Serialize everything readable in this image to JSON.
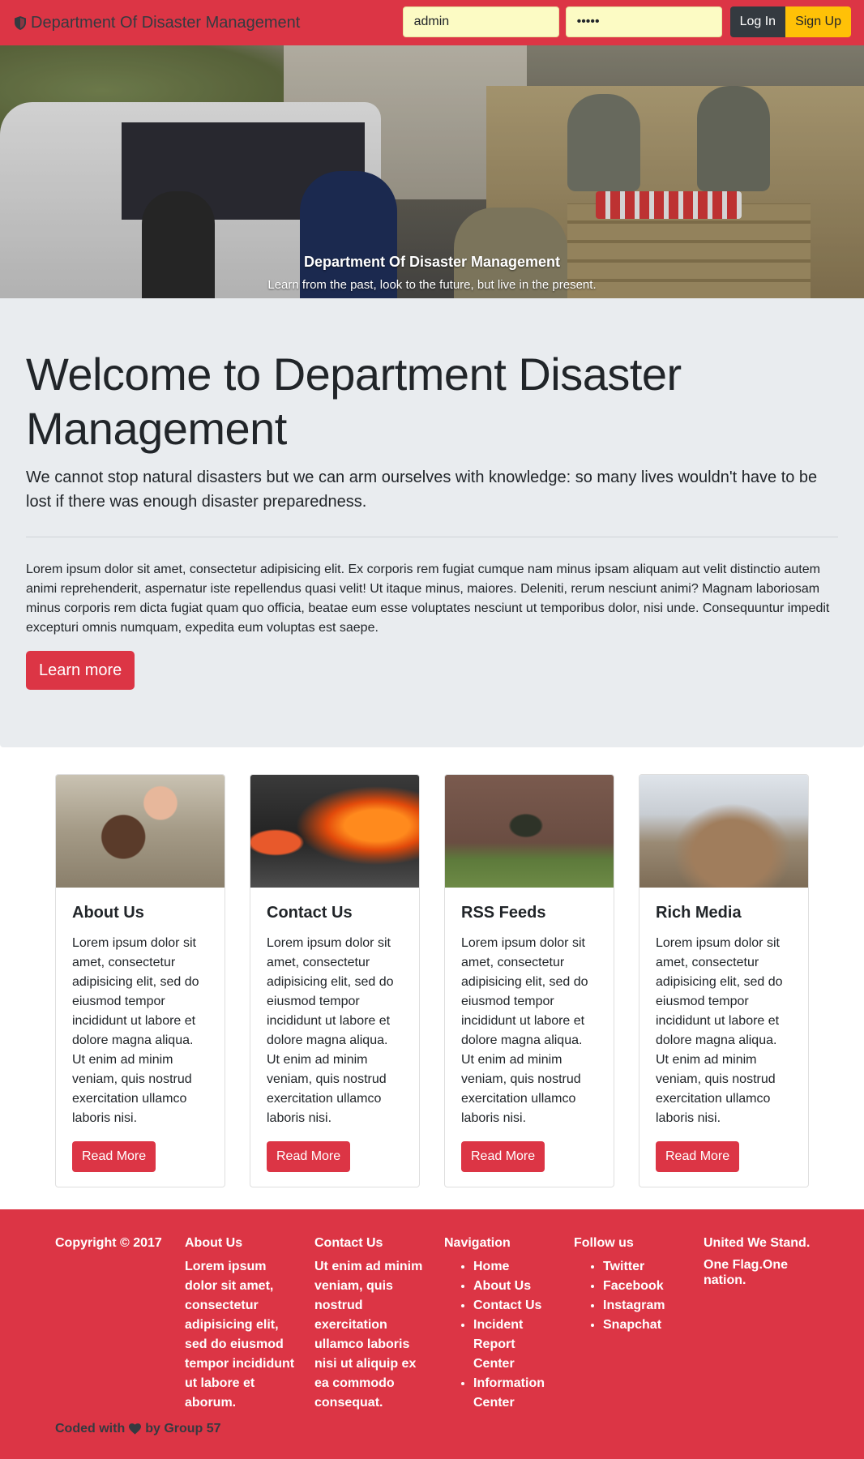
{
  "navbar": {
    "brand": "Department Of Disaster Management",
    "username_value": "admin",
    "password_value": "•••••",
    "login_label": "Log In",
    "signup_label": "Sign Up"
  },
  "hero": {
    "caption_title": "Department Of Disaster Management",
    "caption_text": "Learn from the past, look to the future, but live in the present."
  },
  "jumbotron": {
    "heading": "Welcome to Department Disaster Management",
    "lead": "We cannot stop natural disasters but we can arm ourselves with knowledge: so many lives wouldn't have to be lost if there was enough disaster preparedness.",
    "body": "Lorem ipsum dolor sit amet, consectetur adipisicing elit. Ex corporis rem fugiat cumque nam minus ipsam aliquam aut velit distinctio autem animi reprehenderit, aspernatur iste repellendus quasi velit! Ut itaque minus, maiores. Deleniti, rerum nesciunt animi? Magnam laboriosam minus corporis rem dicta fugiat quam quo officia, beatae eum esse voluptates nesciunt ut temporibus dolor, nisi unde. Consequuntur impedit excepturi omnis numquam, expedita eum voluptas est saepe.",
    "button_label": "Learn more"
  },
  "cards": [
    {
      "title": "About Us",
      "text": "Lorem ipsum dolor sit amet, consectetur adipisicing elit, sed do eiusmod tempor incididunt ut labore et dolore magna aliqua. Ut enim ad minim veniam, quis nostrud exercitation ullamco laboris nisi.",
      "button": "Read More"
    },
    {
      "title": "Contact Us",
      "text": "Lorem ipsum dolor sit amet, consectetur adipisicing elit, sed do eiusmod tempor incididunt ut labore et dolore magna aliqua. Ut enim ad minim veniam, quis nostrud exercitation ullamco laboris nisi.",
      "button": "Read More"
    },
    {
      "title": "RSS Feeds",
      "text": "Lorem ipsum dolor sit amet, consectetur adipisicing elit, sed do eiusmod tempor incididunt ut labore et dolore magna aliqua. Ut enim ad minim veniam, quis nostrud exercitation ullamco laboris nisi.",
      "button": "Read More"
    },
    {
      "title": "Rich Media",
      "text": "Lorem ipsum dolor sit amet, consectetur adipisicing elit, sed do eiusmod tempor incididunt ut labore et dolore magna aliqua. Ut enim ad minim veniam, quis nostrud exercitation ullamco laboris nisi.",
      "button": "Read More"
    }
  ],
  "footer": {
    "copyright": "Copyright © 2017",
    "about_title": "About Us",
    "about_text": "Lorem ipsum dolor sit amet, consectetur adipisicing elit, sed do eiusmod tempor incididunt ut labore et aborum.",
    "contact_title": "Contact Us",
    "contact_text": "Ut enim ad minim veniam, quis nostrud exercitation ullamco laboris nisi ut aliquip ex ea commodo consequat.",
    "nav_title": "Navigation",
    "nav_items": [
      "Home",
      "About Us",
      "Contact Us",
      "Incident Report Center",
      "Information Center"
    ],
    "follow_title": "Follow us",
    "follow_items": [
      "Twitter",
      "Facebook",
      "Instagram",
      "Snapchat"
    ],
    "motto_1": "United We Stand.",
    "motto_2": "One Flag.One nation.",
    "coded_prefix": "Coded with",
    "coded_suffix": "by Group 57"
  },
  "colors": {
    "brand_red": "#dc3545",
    "dark": "#343a40",
    "warning": "#ffc107",
    "jumbotron_bg": "#e9ecef",
    "input_bg": "#fcfbc4"
  },
  "icons": {
    "brand": "shield-icon",
    "footer": "heart-icon"
  }
}
